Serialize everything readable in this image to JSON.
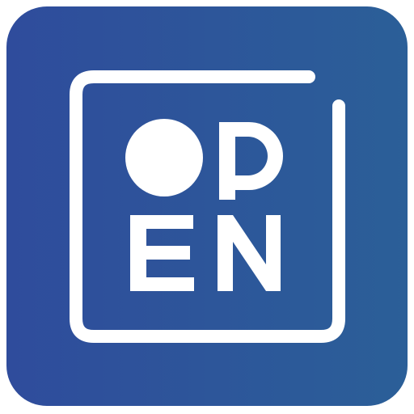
{
  "logo": {
    "text": "OPEN",
    "letters": [
      "O",
      "P",
      "E",
      "N"
    ],
    "colors": {
      "background_start": "#2f4c9c",
      "background_end": "#2b5f98",
      "foreground": "#ffffff"
    },
    "icon_name": "open-logo-icon"
  }
}
